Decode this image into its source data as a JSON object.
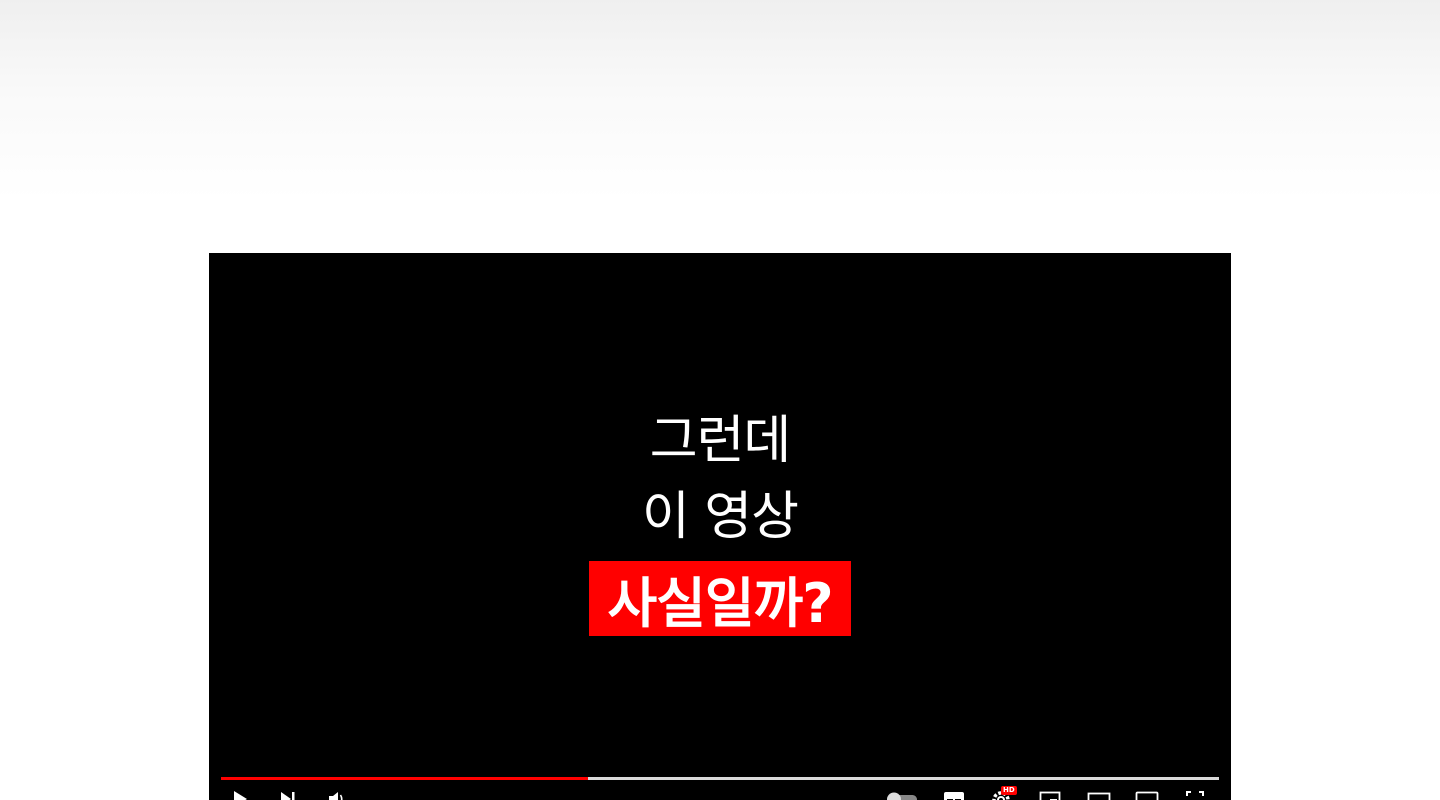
{
  "video": {
    "caption_line1": "그런데",
    "caption_line2": "이 영상",
    "caption_highlight": "사실일까?",
    "highlight_color": "#ff0000",
    "progress_fraction": 0.368
  },
  "controls": {
    "left_icons": [
      "play-icon",
      "next-icon",
      "volume-icon"
    ],
    "right_icons": [
      "autoplay-toggle-icon",
      "subtitles-icon",
      "settings-icon",
      "miniplayer-icon",
      "theater-mode-icon",
      "cast-icon",
      "fullscreen-icon"
    ],
    "settings_badge": "HD"
  }
}
